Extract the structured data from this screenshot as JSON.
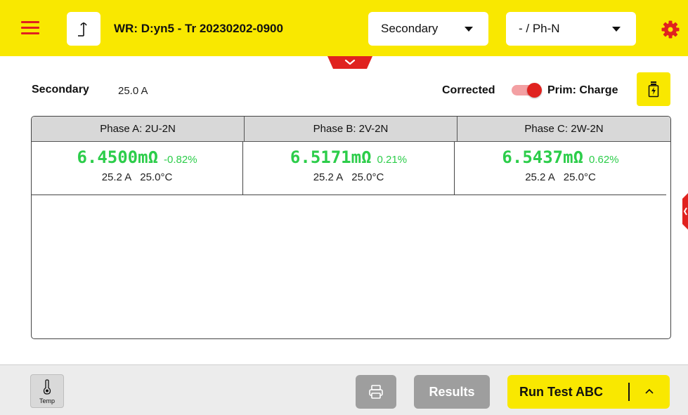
{
  "header": {
    "title": "WR: D:yn5 - Tr 20230202-0900",
    "winding_select": "Secondary",
    "connection_select": "- / Ph-N"
  },
  "summary": {
    "label": "Secondary",
    "current": "25.0 A",
    "corrected_label": "Corrected",
    "toggle_label": "Prim: Charge",
    "toggle_on": true
  },
  "table": {
    "headers": [
      "Phase A: 2U-2N",
      "Phase B: 2V-2N",
      "Phase C: 2W-2N"
    ],
    "rows": [
      {
        "cells": [
          {
            "resistance": "6.4500mΩ",
            "deviation": "-0.82%",
            "current": "25.2 A",
            "temperature": "25.0°C"
          },
          {
            "resistance": "6.5171mΩ",
            "deviation": "0.21%",
            "current": "25.2 A",
            "temperature": "25.0°C"
          },
          {
            "resistance": "6.5437mΩ",
            "deviation": "0.62%",
            "current": "25.2 A",
            "temperature": "25.0°C"
          }
        ]
      }
    ]
  },
  "footer": {
    "temp_label": "Temp",
    "results_label": "Results",
    "run_label": "Run Test ABC"
  },
  "colors": {
    "brand_yellow": "#f9e800",
    "accent_red": "#e0221f",
    "value_green": "#2ccd4a",
    "disabled_gray": "#9e9e9e"
  }
}
